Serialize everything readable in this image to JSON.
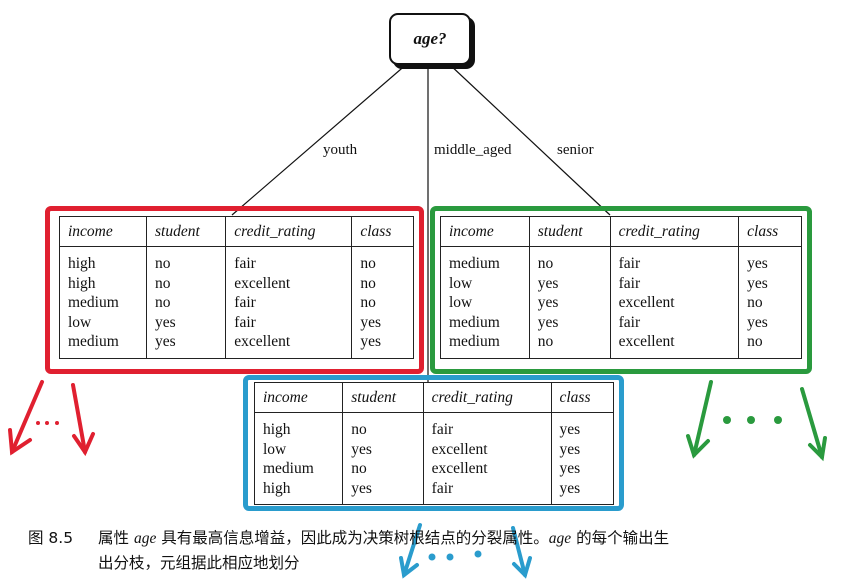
{
  "root_node": {
    "label": "age?"
  },
  "branches": [
    {
      "label": "youth"
    },
    {
      "label": "middle_aged"
    },
    {
      "label": "senior"
    }
  ],
  "columns": [
    "income",
    "student",
    "credit_rating",
    "class"
  ],
  "tables": {
    "youth": {
      "frame_color": "#e02030",
      "rows": [
        [
          "high",
          "no",
          "fair",
          "no"
        ],
        [
          "high",
          "no",
          "excellent",
          "no"
        ],
        [
          "medium",
          "no",
          "fair",
          "no"
        ],
        [
          "low",
          "yes",
          "fair",
          "yes"
        ],
        [
          "medium",
          "yes",
          "excellent",
          "yes"
        ]
      ]
    },
    "senior": {
      "frame_color": "#2a9a3e",
      "rows": [
        [
          "medium",
          "no",
          "fair",
          "yes"
        ],
        [
          "low",
          "yes",
          "fair",
          "yes"
        ],
        [
          "low",
          "yes",
          "excellent",
          "no"
        ],
        [
          "medium",
          "yes",
          "fair",
          "yes"
        ],
        [
          "medium",
          "no",
          "excellent",
          "no"
        ]
      ]
    },
    "middle_aged": {
      "frame_color": "#2a9ccd",
      "rows": [
        [
          "high",
          "no",
          "fair",
          "yes"
        ],
        [
          "low",
          "yes",
          "excellent",
          "yes"
        ],
        [
          "medium",
          "no",
          "excellent",
          "yes"
        ],
        [
          "high",
          "yes",
          "fair",
          "yes"
        ]
      ]
    }
  },
  "continuation": {
    "ellipsis": "...",
    "icon": "arrow-down-icon"
  },
  "caption": {
    "figure_number": "图 8.5",
    "text_part1": "属性 ",
    "term1": "age",
    "text_part2": " 具有最高信息增益，因此成为决策树根结点的分裂属性。",
    "term2": "age",
    "text_part3": " 的每个输出生",
    "line2": "出分枝，元组据此相应地划分"
  }
}
